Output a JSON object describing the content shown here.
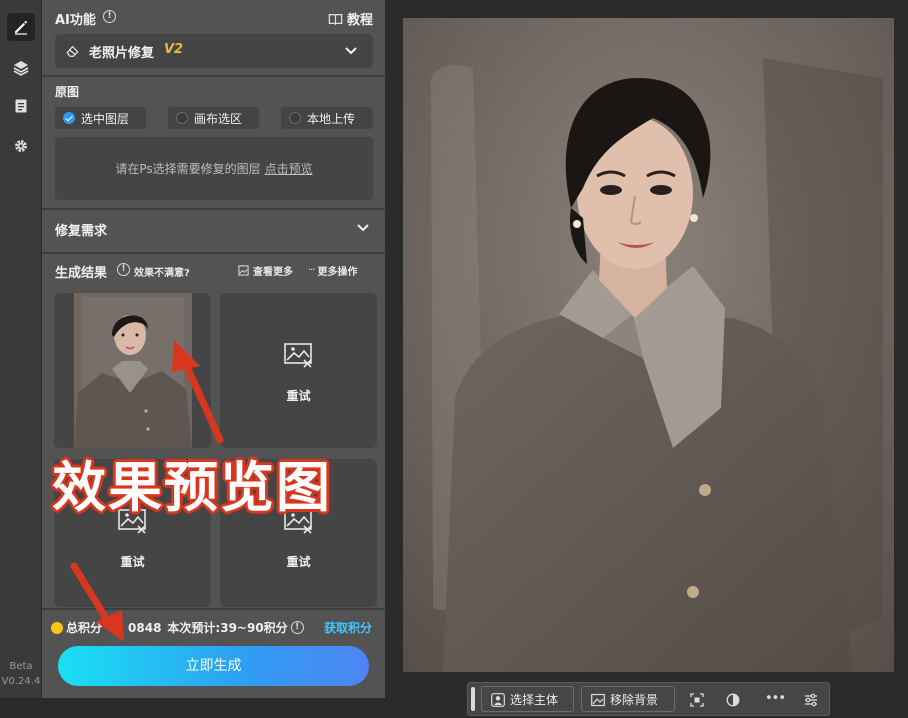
{
  "toolbar": {
    "tools": [
      {
        "icon": "pen-icon",
        "active": true
      },
      {
        "icon": "layers-icon",
        "active": false
      },
      {
        "icon": "notes-icon",
        "active": false
      },
      {
        "icon": "gear-icon",
        "active": false
      }
    ],
    "beta_label": "Beta",
    "version": "V0.24.4"
  },
  "panel": {
    "ai_feature_label": "AI功能",
    "tutorial_label": "教程",
    "selected_feature": "老照片修复",
    "feature_version": "V2",
    "source_label": "原图",
    "source_options": [
      {
        "label": "选中图层",
        "selected": true
      },
      {
        "label": "画布选区",
        "selected": false
      },
      {
        "label": "本地上传",
        "selected": false
      }
    ],
    "preview_hint": "请在Ps选择需要修复的图层",
    "preview_link": "点击预览",
    "repair_needs_label": "修复需求",
    "results_label": "生成结果",
    "unsatisfied_label": "效果不满意?",
    "view_more_label": "查看更多",
    "more_actions_label": "更多操作",
    "retry_label": "重试",
    "credits_prefix": "总积分",
    "credits_value": "0848",
    "estimate_text": "本次预计:39~90积分",
    "get_credits_label": "获取积分",
    "generate_label": "立即生成"
  },
  "bottom_bar": {
    "select_subject_label": "选择主体",
    "remove_bg_label": "移除背景"
  },
  "annotation": {
    "text": "效果预览图"
  },
  "colors": {
    "accent_blue": "#2d9cf0",
    "get_credits": "#3ec8ff",
    "version_gold": "#e8b84a",
    "annotation_red": "#d8361f"
  }
}
